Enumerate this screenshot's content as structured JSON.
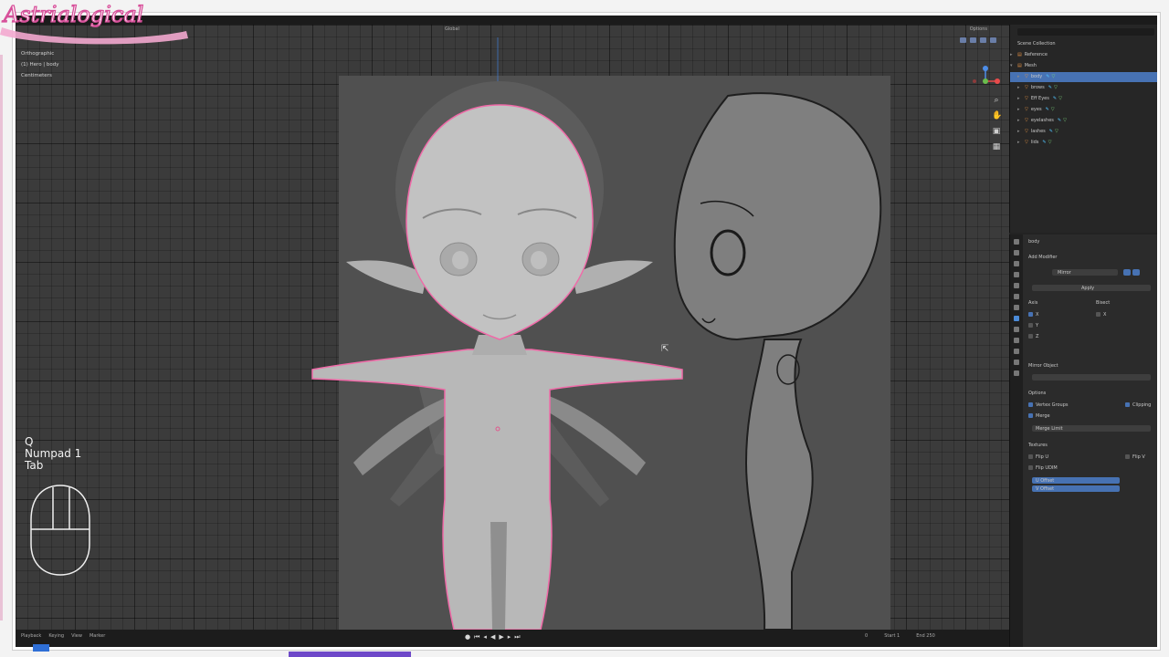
{
  "logo": {
    "text": "Astrialogical"
  },
  "menu": {
    "items": [
      "",
      "",
      "",
      "",
      "",
      "",
      "",
      "",
      "",
      ""
    ]
  },
  "viewport": {
    "header": {
      "orientation": "Global",
      "options_label": "Options"
    },
    "overlay": {
      "view_name": "Orthographic",
      "collection_line": "(1) Hero | body",
      "units": "Centimeters"
    }
  },
  "keys_overlay": {
    "line1": "Q",
    "line2": "Numpad 1",
    "line3": "Tab"
  },
  "outliner": {
    "title": "Scene Collection",
    "items": [
      {
        "label": "Reference",
        "selected": false
      },
      {
        "label": "Mesh",
        "selected": false
      },
      {
        "label": "body",
        "selected": true
      },
      {
        "label": "brows",
        "selected": false
      },
      {
        "label": "Eff Eyes",
        "selected": false
      },
      {
        "label": "eyes",
        "selected": false
      },
      {
        "label": "eyelashes",
        "selected": false
      },
      {
        "label": "lashes",
        "selected": false
      },
      {
        "label": "lids",
        "selected": false
      }
    ]
  },
  "properties": {
    "object_name": "body",
    "add_modifier": "Add Modifier",
    "modifier_name": "Mirror",
    "apply_label": "Apply",
    "axis_label": "Axis",
    "bisect_label": "Bisect",
    "axis_values": [
      "X",
      "Y",
      "Z"
    ],
    "mirror_object_label": "Mirror Object",
    "options_label": "Options",
    "vertex_groups": "Vertex Groups",
    "clipping": "Clipping",
    "merge": "Merge",
    "merge_limit": "Merge Limit",
    "textures_label": "Textures",
    "flip_u": "Flip U",
    "flip_v": "Flip V",
    "flip_udim": "Flip UDIM",
    "u_offset": "U Offset",
    "v_offset": "V Offset"
  },
  "timeline": {
    "playback": "Playback",
    "keying": "Keying",
    "view": "View",
    "marker": "Marker",
    "current_frame": "0",
    "start_label": "Start",
    "start_value": "1",
    "end_label": "End",
    "end_value": "250"
  },
  "colors": {
    "selection_outline": "#f06aa8",
    "highlight_blue": "#4772b3",
    "bar_purple": "#6e49c9"
  }
}
